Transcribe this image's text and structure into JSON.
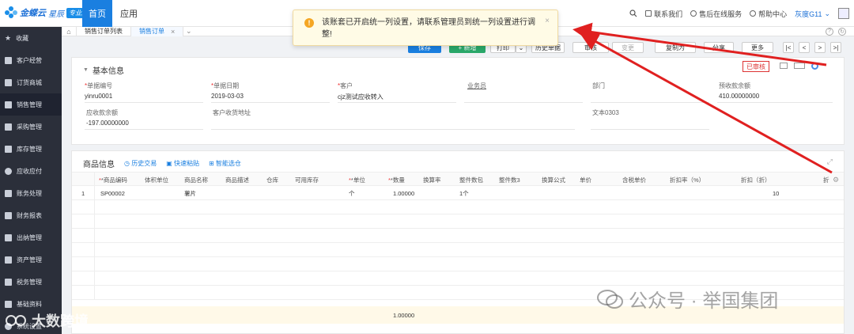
{
  "brand": {
    "name": "金蝶云",
    "sub": "星辰",
    "badge": "专业版"
  },
  "topnav": {
    "home": "首页",
    "app": "应用"
  },
  "topright": {
    "contact": "联系我们",
    "service": "售后在线服务",
    "help": "帮助中心",
    "user": "灰度G11"
  },
  "sidebar": [
    {
      "label": "收藏"
    },
    {
      "label": "客户经营"
    },
    {
      "label": "订货商城"
    },
    {
      "label": "销售管理"
    },
    {
      "label": "采购管理"
    },
    {
      "label": "库存管理"
    },
    {
      "label": "应收应付"
    },
    {
      "label": "账务处理"
    },
    {
      "label": "财务报表"
    },
    {
      "label": "出纳管理"
    },
    {
      "label": "资产管理"
    },
    {
      "label": "税务管理"
    },
    {
      "label": "基础资料"
    },
    {
      "label": "系统设置"
    }
  ],
  "tabs": [
    {
      "label": "销售订单列表"
    },
    {
      "label": "销售订单"
    }
  ],
  "toolbar": {
    "save": "保存",
    "new": "+ 新增",
    "print": "打印",
    "history": "历史单据",
    "audit": "审核",
    "change": "变更",
    "copy": "复制为",
    "share": "分享",
    "more": "更多"
  },
  "popup": {
    "message": "该账套已开启统一列设置，请联系管理员到统一列设置进行调整!"
  },
  "basic": {
    "title": "基本信息",
    "stamp": "已审核",
    "fields": [
      {
        "label": "单据编号",
        "required": true,
        "value": "yinru0001"
      },
      {
        "label": "单据日期",
        "required": true,
        "value": "2019-03-03"
      },
      {
        "label": "客户",
        "required": true,
        "value": "cjz测试应收转入"
      },
      {
        "label": "业务员",
        "required": false,
        "value": ""
      },
      {
        "label": "部门",
        "required": false,
        "value": ""
      },
      {
        "label": "预收款余额",
        "required": false,
        "value": "410.00000000"
      },
      {
        "label": "应收款余额",
        "required": false,
        "value": "-197.00000000"
      },
      {
        "label": "客户收货地址",
        "required": false,
        "value": ""
      },
      {
        "label": "文本0303",
        "required": false,
        "value": ""
      }
    ]
  },
  "goods": {
    "title": "商品信息",
    "links": [
      "历史交易",
      "快速粘贴",
      "智能选仓"
    ],
    "columns": [
      "*商品编码",
      "体积单位",
      "商品名称",
      "商品描述",
      "仓库",
      "可用库存",
      "*单位",
      "*数量",
      "换算率",
      "整件数包",
      "整件数3",
      "换算公式",
      "单价",
      "含税单价",
      "折扣率（%）",
      "折扣（折）",
      "折"
    ],
    "rows": [
      {
        "idx": "1",
        "code": "SP00002",
        "name": "薯片",
        "unit": "个",
        "qty": "1.00000",
        "pack": "1个",
        "disc": "10"
      }
    ],
    "sum_qty": "1.00000"
  },
  "watermarks": {
    "right": "公众号 · 举国集团",
    "left": "大数跨境"
  },
  "colors": {
    "primary": "#1a7fe0",
    "green": "#2aa86a",
    "sidebar": "#2b2f3a",
    "arrow": "#e02020"
  }
}
